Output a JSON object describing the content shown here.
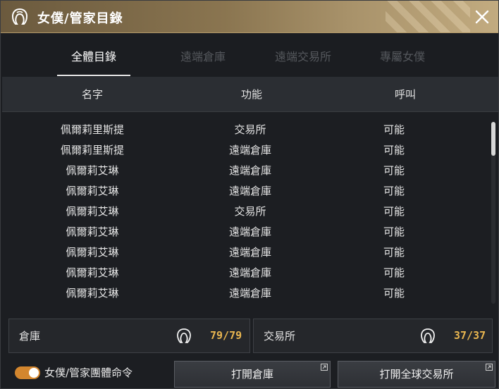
{
  "window": {
    "title": "女僕/管家目錄",
    "title_icon": "maid-icon",
    "close_icon": "close-icon"
  },
  "tabs": [
    {
      "label": "全體目錄",
      "active": true
    },
    {
      "label": "遠端倉庫",
      "active": false
    },
    {
      "label": "遠端交易所",
      "active": false
    },
    {
      "label": "專屬女僕",
      "active": false
    }
  ],
  "columns": {
    "name": "名字",
    "function": "功能",
    "call": "呼叫"
  },
  "rows": [
    {
      "name": "佩爾莉里斯提",
      "function": "交易所",
      "call": "可能"
    },
    {
      "name": "佩爾莉里斯提",
      "function": "遠端倉庫",
      "call": "可能"
    },
    {
      "name": "佩爾莉艾琳",
      "function": "遠端倉庫",
      "call": "可能"
    },
    {
      "name": "佩爾莉艾琳",
      "function": "遠端倉庫",
      "call": "可能"
    },
    {
      "name": "佩爾莉艾琳",
      "function": "交易所",
      "call": "可能"
    },
    {
      "name": "佩爾莉艾琳",
      "function": "遠端倉庫",
      "call": "可能"
    },
    {
      "name": "佩爾莉艾琳",
      "function": "遠端倉庫",
      "call": "可能"
    },
    {
      "name": "佩爾莉艾琳",
      "function": "遠端倉庫",
      "call": "可能"
    },
    {
      "name": "佩爾莉艾琳",
      "function": "遠端倉庫",
      "call": "可能"
    }
  ],
  "panels": {
    "warehouse": {
      "label": "倉庫",
      "count": "79/79",
      "icon": "maid-icon"
    },
    "market": {
      "label": "交易所",
      "count": "37/37",
      "icon": "maid-icon"
    }
  },
  "footer": {
    "toggle_label": "女僕/管家團體命令",
    "toggle_on": true,
    "open_warehouse": "打開倉庫",
    "open_market": "打開全球交易所"
  },
  "colors": {
    "accent_gold": "#e9b650",
    "toggle_orange": "#d3862e",
    "title_bar": "#8a7550"
  }
}
